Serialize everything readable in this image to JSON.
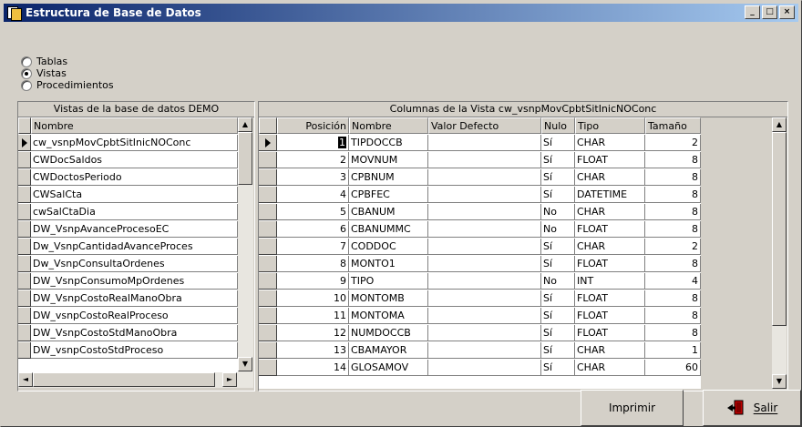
{
  "window": {
    "title": "Estructura de Base de Datos"
  },
  "options": [
    {
      "label": "Tablas",
      "selected": false
    },
    {
      "label": "Vistas",
      "selected": true
    },
    {
      "label": "Procedimientos",
      "selected": false
    }
  ],
  "left_panel": {
    "title": "Vistas de la base de datos DEMO",
    "column_header": "Nombre",
    "items": [
      "cw_vsnpMovCpbtSitInicNOConc",
      "CWDocSaldos",
      "CWDoctosPeriodo",
      "CWSalCta",
      "cwSalCtaDia",
      "DW_VsnpAvanceProcesoEC",
      "Dw_VsnpCantidadAvanceProces",
      "Dw_VsnpConsultaOrdenes",
      "DW_VsnpConsumoMpOrdenes",
      "DW_VsnpCostoRealManoObra",
      "DW_vsnpCostoRealProceso",
      "DW_VsnpCostoStdManoObra",
      "DW_vsnpCostoStdProceso"
    ]
  },
  "right_panel": {
    "title": "Columnas de la Vista cw_vsnpMovCpbtSitInicNOConc",
    "headers": [
      "Posición",
      "Nombre",
      "Valor Defecto",
      "Nulo",
      "Tipo",
      "Tamaño"
    ],
    "rows": [
      [
        "1",
        "TIPDOCCB",
        "",
        "Sí",
        "CHAR",
        "2"
      ],
      [
        "2",
        "MOVNUM",
        "",
        "Sí",
        "FLOAT",
        "8"
      ],
      [
        "3",
        "CPBNUM",
        "",
        "Sí",
        "CHAR",
        "8"
      ],
      [
        "4",
        "CPBFEC",
        "",
        "Sí",
        "DATETIME",
        "8"
      ],
      [
        "5",
        "CBANUM",
        "",
        "No",
        "CHAR",
        "8"
      ],
      [
        "6",
        "CBANUMMC",
        "",
        "No",
        "FLOAT",
        "8"
      ],
      [
        "7",
        "CODDOC",
        "",
        "Sí",
        "CHAR",
        "2"
      ],
      [
        "8",
        "MONTO1",
        "",
        "Sí",
        "FLOAT",
        "8"
      ],
      [
        "9",
        "TIPO",
        "",
        "No",
        "INT",
        "4"
      ],
      [
        "10",
        "MONTOMB",
        "",
        "Sí",
        "FLOAT",
        "8"
      ],
      [
        "11",
        "MONTOMA",
        "",
        "Sí",
        "FLOAT",
        "8"
      ],
      [
        "12",
        "NUMDOCCB",
        "",
        "Sí",
        "FLOAT",
        "8"
      ],
      [
        "13",
        "CBAMAYOR",
        "",
        "Sí",
        "CHAR",
        "1"
      ],
      [
        "14",
        "GLOSAMOV",
        "",
        "Sí",
        "CHAR",
        "60"
      ]
    ]
  },
  "buttons": {
    "print": "Imprimir",
    "exit": "Salir"
  },
  "colors": {
    "titlebar_start": "#0a246a",
    "titlebar_end": "#a6caf0",
    "face": "#d4d0c8"
  },
  "icons": [
    "app-icon",
    "minimize-icon",
    "maximize-icon",
    "close-icon",
    "row-pointer-icon",
    "exit-door-icon"
  ]
}
